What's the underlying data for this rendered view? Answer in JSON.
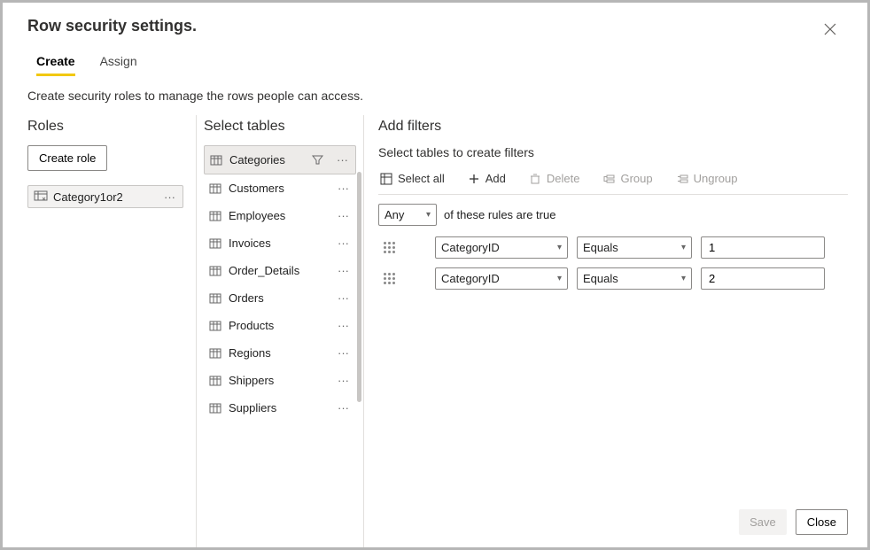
{
  "title": "Row security settings.",
  "tabs": {
    "create": "Create",
    "assign": "Assign",
    "active": "create"
  },
  "subheader": "Create security roles to manage the rows people can access.",
  "roles": {
    "heading": "Roles",
    "create_button": "Create role",
    "items": [
      {
        "name": "Category1or2"
      }
    ]
  },
  "tables": {
    "heading": "Select tables",
    "items": [
      {
        "name": "Categories",
        "selected": true,
        "filtered": true
      },
      {
        "name": "Customers"
      },
      {
        "name": "Employees"
      },
      {
        "name": "Invoices"
      },
      {
        "name": "Order_Details"
      },
      {
        "name": "Orders"
      },
      {
        "name": "Products"
      },
      {
        "name": "Regions"
      },
      {
        "name": "Shippers"
      },
      {
        "name": "Suppliers"
      }
    ]
  },
  "filters": {
    "heading": "Add filters",
    "subheading": "Select tables to create filters",
    "toolbar": {
      "select_all": "Select all",
      "add": "Add",
      "delete": "Delete",
      "group": "Group",
      "ungroup": "Ungroup"
    },
    "match": {
      "mode": "Any",
      "suffix": "of these rules are true"
    },
    "rules": [
      {
        "field": "CategoryID",
        "operator": "Equals",
        "value": "1"
      },
      {
        "field": "CategoryID",
        "operator": "Equals",
        "value": "2"
      }
    ]
  },
  "footer": {
    "save": "Save",
    "close": "Close"
  }
}
